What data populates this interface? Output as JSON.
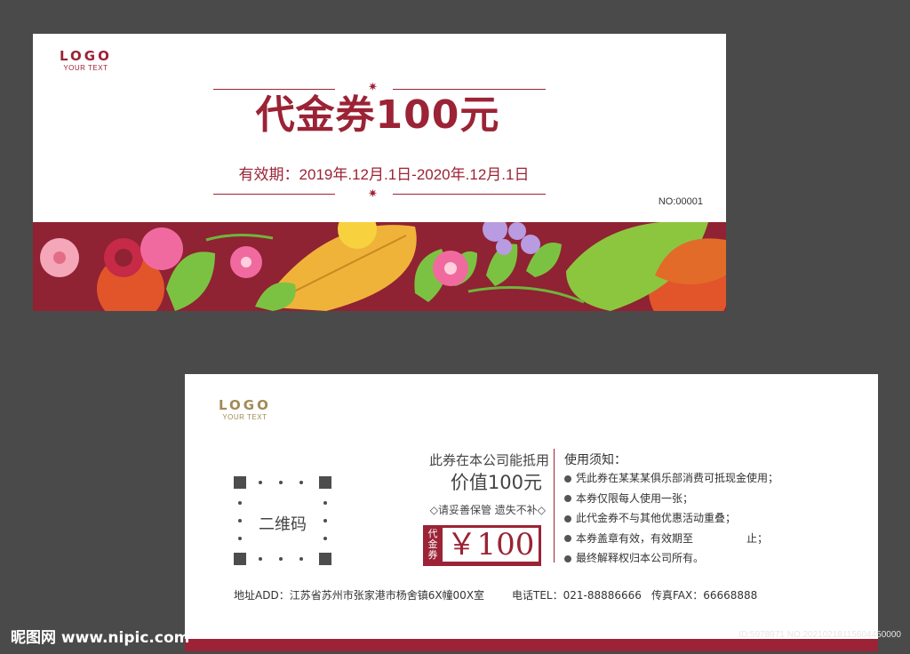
{
  "front": {
    "logo": "LOGO",
    "logo_sub": "YOUR TEXT",
    "title": "代金券100元",
    "validity": "有效期：2019年.12月.1日-2020年.12月.1日",
    "serial": "NO:00001",
    "colors": {
      "brand": "#9b2335",
      "banner": "#8f2233"
    }
  },
  "back": {
    "logo": "LOGO",
    "logo_sub": "YOUR TEXT",
    "qr_label": "二维码",
    "accept_line": "此券在本公司能抵用",
    "worth_line": "价值100元",
    "keep_line": "◇请妥善保管 遗失不补◇",
    "stamp_label": "代金券",
    "stamp_amount": "￥100",
    "rules_title": "使用须知：",
    "rules": [
      "凭此券在某某某俱乐部消费可抵现金使用；",
      "本券仅限每人使用一张；",
      "此代金券不与其他优惠活动重叠；",
      "本券盖章有效，有效期至　　　　　止；",
      "最终解释权归本公司所有。"
    ],
    "address": "地址ADD：江苏省苏州市张家港市杨舍镇6X幢00X室",
    "tel": "电话TEL：021-88886666",
    "fax": "传真FAX：66668888"
  },
  "watermark": {
    "site": "昵图网 www.nipic.com",
    "id": "ID:5978971 NO:20210218115604450000"
  }
}
